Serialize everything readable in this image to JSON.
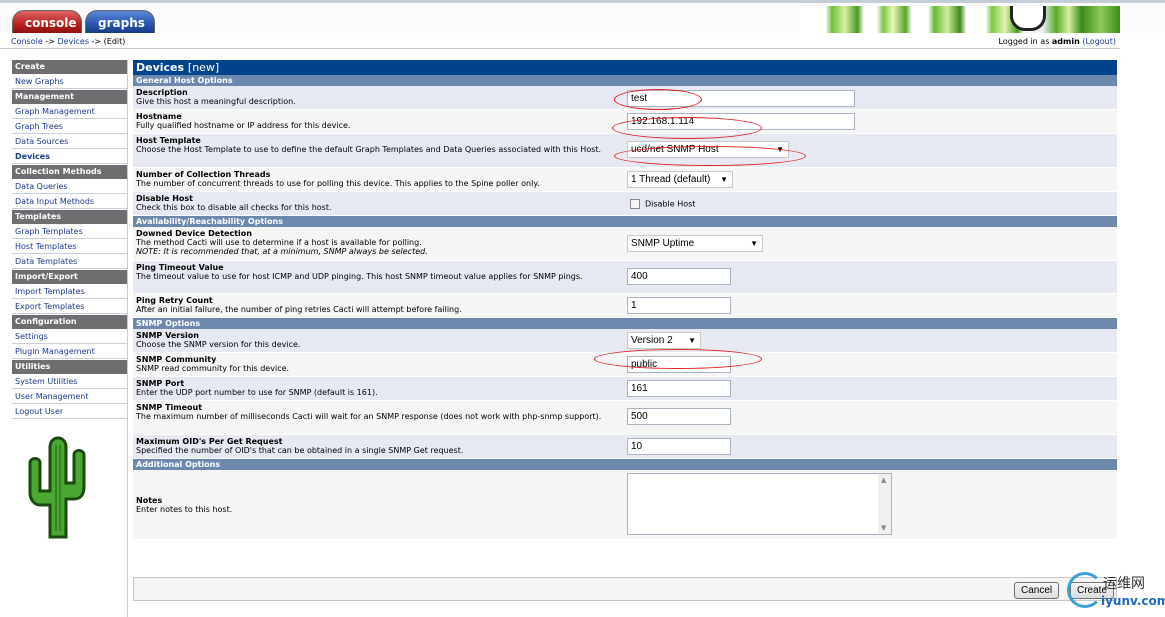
{
  "tabs": {
    "console": "console",
    "graphs": "graphs"
  },
  "breadcrumb": {
    "console": "Console",
    "sep1": " -> ",
    "devices": "Devices",
    "sep2": " -> ",
    "edit": "(Edit)"
  },
  "login": {
    "prefix": "Logged in as ",
    "user": "admin",
    "logout": "(Logout)"
  },
  "sidebar": [
    {
      "type": "head",
      "label": "Create"
    },
    {
      "type": "item",
      "label": "New Graphs"
    },
    {
      "type": "head",
      "label": "Management"
    },
    {
      "type": "item",
      "label": "Graph Management"
    },
    {
      "type": "item",
      "label": "Graph Trees"
    },
    {
      "type": "item",
      "label": "Data Sources"
    },
    {
      "type": "item",
      "label": "Devices",
      "active": true
    },
    {
      "type": "head",
      "label": "Collection Methods"
    },
    {
      "type": "item",
      "label": "Data Queries"
    },
    {
      "type": "item",
      "label": "Data Input Methods"
    },
    {
      "type": "head",
      "label": "Templates"
    },
    {
      "type": "item",
      "label": "Graph Templates"
    },
    {
      "type": "item",
      "label": "Host Templates"
    },
    {
      "type": "item",
      "label": "Data Templates"
    },
    {
      "type": "head",
      "label": "Import/Export"
    },
    {
      "type": "item",
      "label": "Import Templates"
    },
    {
      "type": "item",
      "label": "Export Templates"
    },
    {
      "type": "head",
      "label": "Configuration"
    },
    {
      "type": "item",
      "label": "Settings"
    },
    {
      "type": "item",
      "label": "Plugin Management"
    },
    {
      "type": "head",
      "label": "Utilities"
    },
    {
      "type": "item",
      "label": "System Utilities"
    },
    {
      "type": "item",
      "label": "User Management"
    },
    {
      "type": "item",
      "label": "Logout User"
    }
  ],
  "main": {
    "title": "Devices",
    "title_suffix": "[new]",
    "sections": {
      "general": "General Host Options",
      "availability": "Availability/Reachability Options",
      "snmp": "SNMP Options",
      "additional": "Additional Options"
    },
    "fields": {
      "description": {
        "label": "Description",
        "help": "Give this host a meaningful description.",
        "value": "test"
      },
      "hostname": {
        "label": "Hostname",
        "help": "Fully qualified hostname or IP address for this device.",
        "value": "192.168.1.114"
      },
      "host_template": {
        "label": "Host Template",
        "help": "Choose the Host Template to use to define the default Graph Templates and Data Queries associated with this Host.",
        "value": "ucd/net SNMP Host"
      },
      "threads": {
        "label": "Number of Collection Threads",
        "help": "The number of concurrent threads to use for polling this device. This applies to the Spine poller only.",
        "value": "1 Thread (default)"
      },
      "disable_host": {
        "label": "Disable Host",
        "help": "Check this box to disable all checks for this host.",
        "checkbox_label": "Disable Host"
      },
      "downed_detection": {
        "label": "Downed Device Detection",
        "help": "The method Cacti will use to determine if a host is available for polling.",
        "note": "NOTE: It is recommended that, at a minimum, SNMP always be selected.",
        "value": "SNMP Uptime"
      },
      "ping_timeout": {
        "label": "Ping Timeout Value",
        "help": "The timeout value to use for host ICMP and UDP pinging. This host SNMP timeout value applies for SNMP pings.",
        "value": "400"
      },
      "ping_retry": {
        "label": "Ping Retry Count",
        "help": "After an initial failure, the number of ping retries Cacti will attempt before failing.",
        "value": "1"
      },
      "snmp_version": {
        "label": "SNMP Version",
        "help": "Choose the SNMP version for this device.",
        "value": "Version 2"
      },
      "snmp_community": {
        "label": "SNMP Community",
        "help": "SNMP read community for this device.",
        "value": "public"
      },
      "snmp_port": {
        "label": "SNMP Port",
        "help": "Enter the UDP port number to use for SNMP (default is 161).",
        "value": "161"
      },
      "snmp_timeout": {
        "label": "SNMP Timeout",
        "help": "The maximum number of milliseconds Cacti will wait for an SNMP response (does not work with php-snmp support).",
        "value": "500"
      },
      "max_oids": {
        "label": "Maximum OID's Per Get Request",
        "help": "Specified the number of OID's that can be obtained in a single SNMP Get request.",
        "value": "10"
      },
      "notes": {
        "label": "Notes",
        "help": "Enter notes to this host.",
        "value": ""
      }
    },
    "buttons": {
      "cancel": "Cancel",
      "create": "Create"
    }
  },
  "watermark": {
    "cn": "运维网",
    "url": "iyunv.com"
  },
  "colors": {
    "title_bar": "#00438c",
    "section_bar": "#6d88ad",
    "sidebar_head": "#6e6e70",
    "link": "#1c3a8c",
    "highlight_ellipse": "#e02020"
  }
}
